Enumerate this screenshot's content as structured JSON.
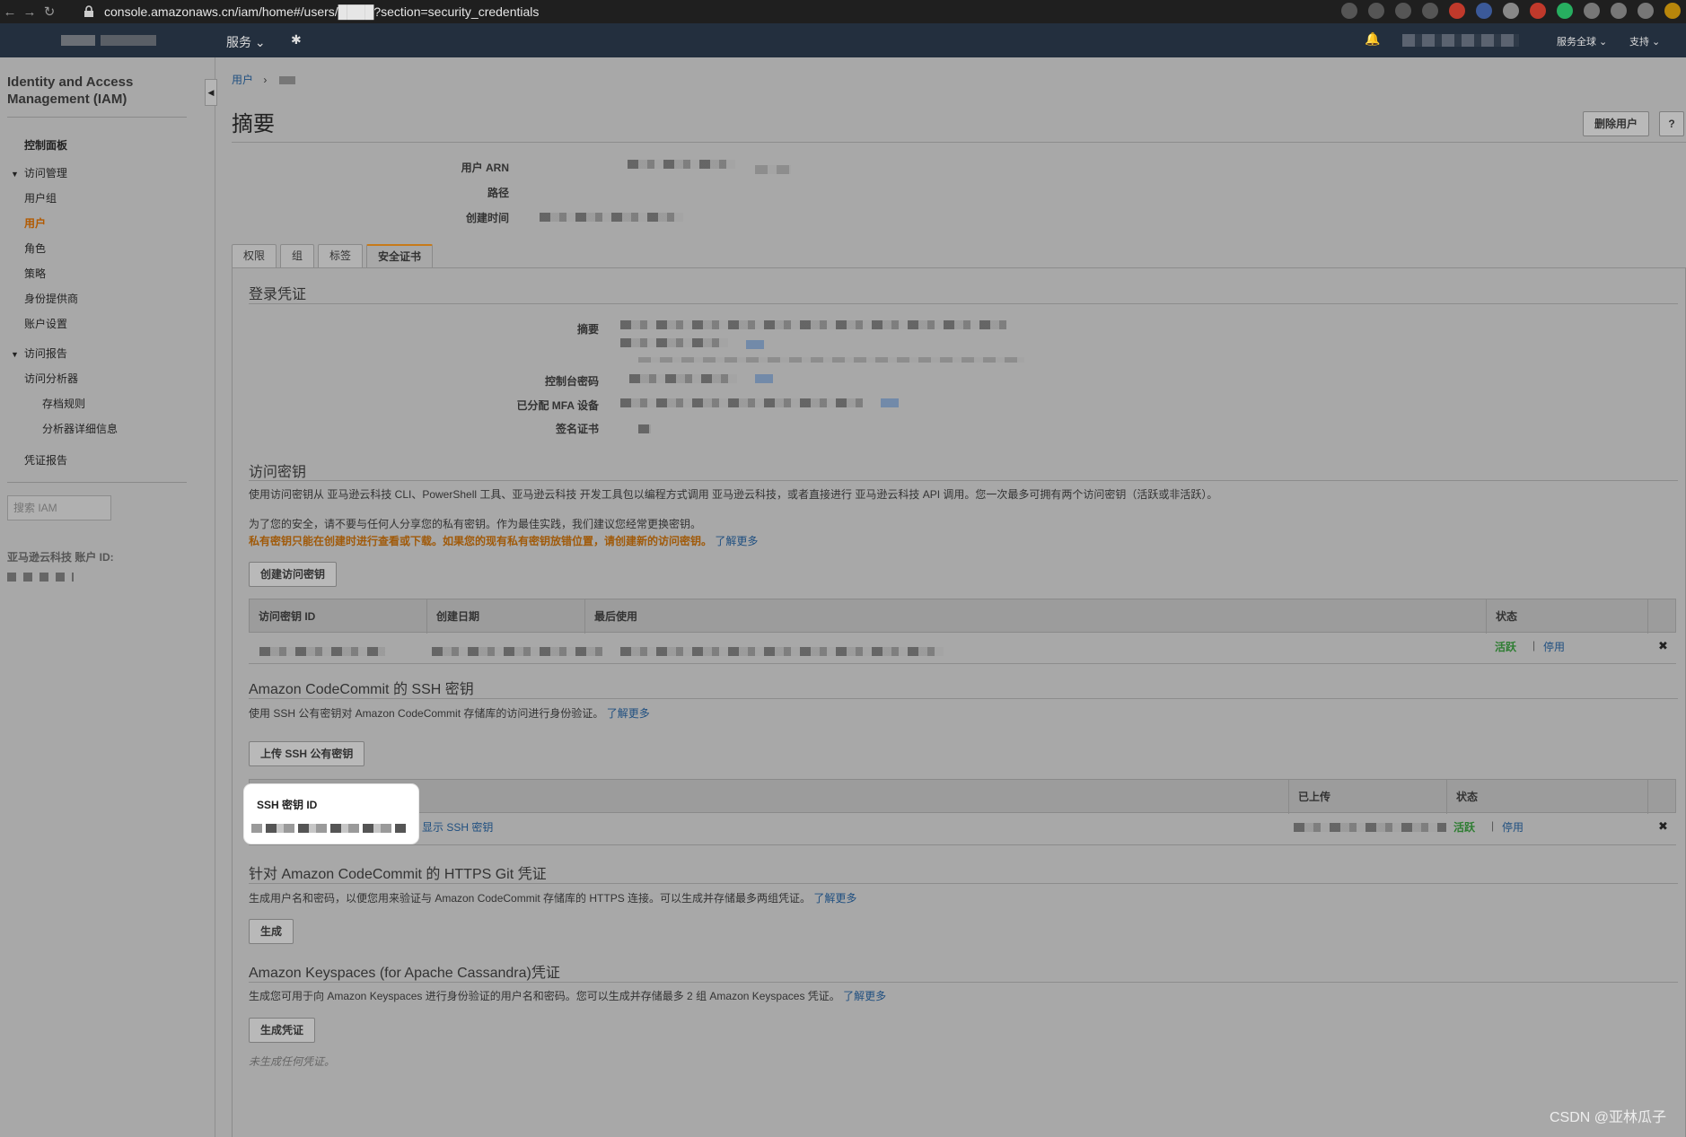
{
  "browser": {
    "url": "console.amazonaws.cn/iam/home#/users/████?section=security_credentials"
  },
  "topnav": {
    "services": "服务",
    "region": "服务全球",
    "support": "支持"
  },
  "sidebar": {
    "title": "Identity and Access Management (IAM)",
    "dashboard": "控制面板",
    "access_mgmt": "访问管理",
    "groups": "用户组",
    "users": "用户",
    "roles": "角色",
    "policies": "策略",
    "identity_providers": "身份提供商",
    "account_settings": "账户设置",
    "access_reports": "访问报告",
    "access_analyzer": "访问分析器",
    "archive_rules": "存档规则",
    "analyzer_details": "分析器详细信息",
    "credential_report": "凭证报告",
    "search_placeholder": "搜索 IAM",
    "account_id_label": "亚马逊云科技 账户 ID:"
  },
  "breadcrumb": {
    "users": "用户"
  },
  "page": {
    "title": "摘要",
    "delete_user": "删除用户",
    "help": "?"
  },
  "summary": {
    "arn_label": "用户 ARN",
    "path_label": "路径",
    "created_label": "创建时间"
  },
  "tabs": [
    "权限",
    "组",
    "标签",
    "安全证书"
  ],
  "login": {
    "title": "登录凭证",
    "summary_label": "摘要",
    "console_pw_label": "控制台密码",
    "mfa_label": "已分配 MFA 设备",
    "signing_cert_label": "签名证书"
  },
  "access_keys": {
    "title": "访问密钥",
    "desc": "使用访问密钥从 亚马逊云科技 CLI、PowerShell 工具、亚马逊云科技 开发工具包以编程方式调用 亚马逊云科技，或者直接进行 亚马逊云科技 API 调用。您一次最多可拥有两个访问密钥（活跃或非活跃）。",
    "security_note": "为了您的安全，请不要与任何人分享您的私有密钥。作为最佳实践，我们建议您经常更换密钥。",
    "warning": "私有密钥只能在创建时进行查看或下载。如果您的现有私有密钥放错位置，请创建新的访问密钥。",
    "learn_more": "了解更多",
    "create_button": "创建访问密钥",
    "columns": [
      "访问密钥 ID",
      "创建日期",
      "最后使用",
      "状态"
    ],
    "row": {
      "status": "活跃",
      "deactivate": "停用"
    }
  },
  "ssh_keys": {
    "title": "Amazon CodeCommit 的 SSH 密钥",
    "desc": "使用 SSH 公有密钥对 Amazon CodeCommit 存储库的访问进行身份验证。",
    "learn_more": "了解更多",
    "upload_button": "上传 SSH 公有密钥",
    "columns": [
      "SSH 密钥 ID",
      "已上传",
      "状态"
    ],
    "row": {
      "show": "显示 SSH 密钥",
      "status": "活跃",
      "deactivate": "停用"
    }
  },
  "https_git": {
    "title": "针对 Amazon CodeCommit 的 HTTPS Git 凭证",
    "desc": "生成用户名和密码，以便您用来验证与 Amazon CodeCommit 存储库的 HTTPS 连接。可以生成并存储最多两组凭证。",
    "learn_more": "了解更多",
    "generate_button": "生成"
  },
  "keyspaces": {
    "title": "Amazon Keyspaces (for Apache Cassandra)凭证",
    "desc": "生成您可用于向 Amazon Keyspaces 进行身份验证的用户名和密码。您可以生成并存储最多 2 组 Amazon Keyspaces 凭证。",
    "learn_more": "了解更多",
    "generate_button": "生成凭证",
    "none": "未生成任何凭证。"
  },
  "watermark": "CSDN @亚林瓜子"
}
